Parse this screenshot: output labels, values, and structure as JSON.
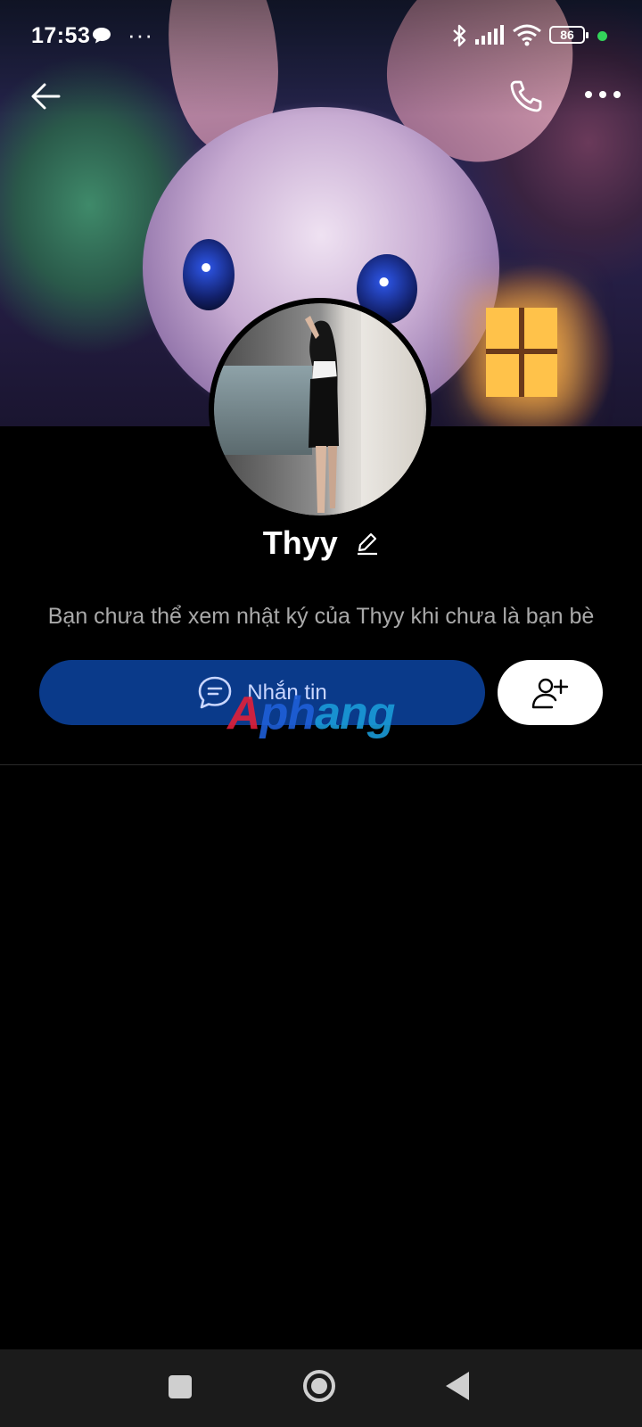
{
  "status_bar": {
    "time": "17:53",
    "dots": "···",
    "battery": "86",
    "icons": [
      "chat-bubble-icon",
      "bluetooth-icon",
      "signal-icon",
      "wifi-icon",
      "battery-icon",
      "green-dot-indicator"
    ]
  },
  "header": {
    "icons": [
      "back-arrow-icon",
      "phone-icon",
      "more-icon"
    ]
  },
  "profile": {
    "name": "Thyy",
    "note": "Bạn chưa thể xem nhật ký của Thyy khi chưa là bạn bè"
  },
  "actions": {
    "message_label": "Nhắn tin",
    "message_icon": "chat-icon",
    "add_friend_icon": "add-friend-icon"
  },
  "watermark": {
    "part1": "A",
    "part2": "ph",
    "part3": "ang"
  },
  "colors": {
    "message_button": "#0a3a8a",
    "background": "#000000"
  }
}
